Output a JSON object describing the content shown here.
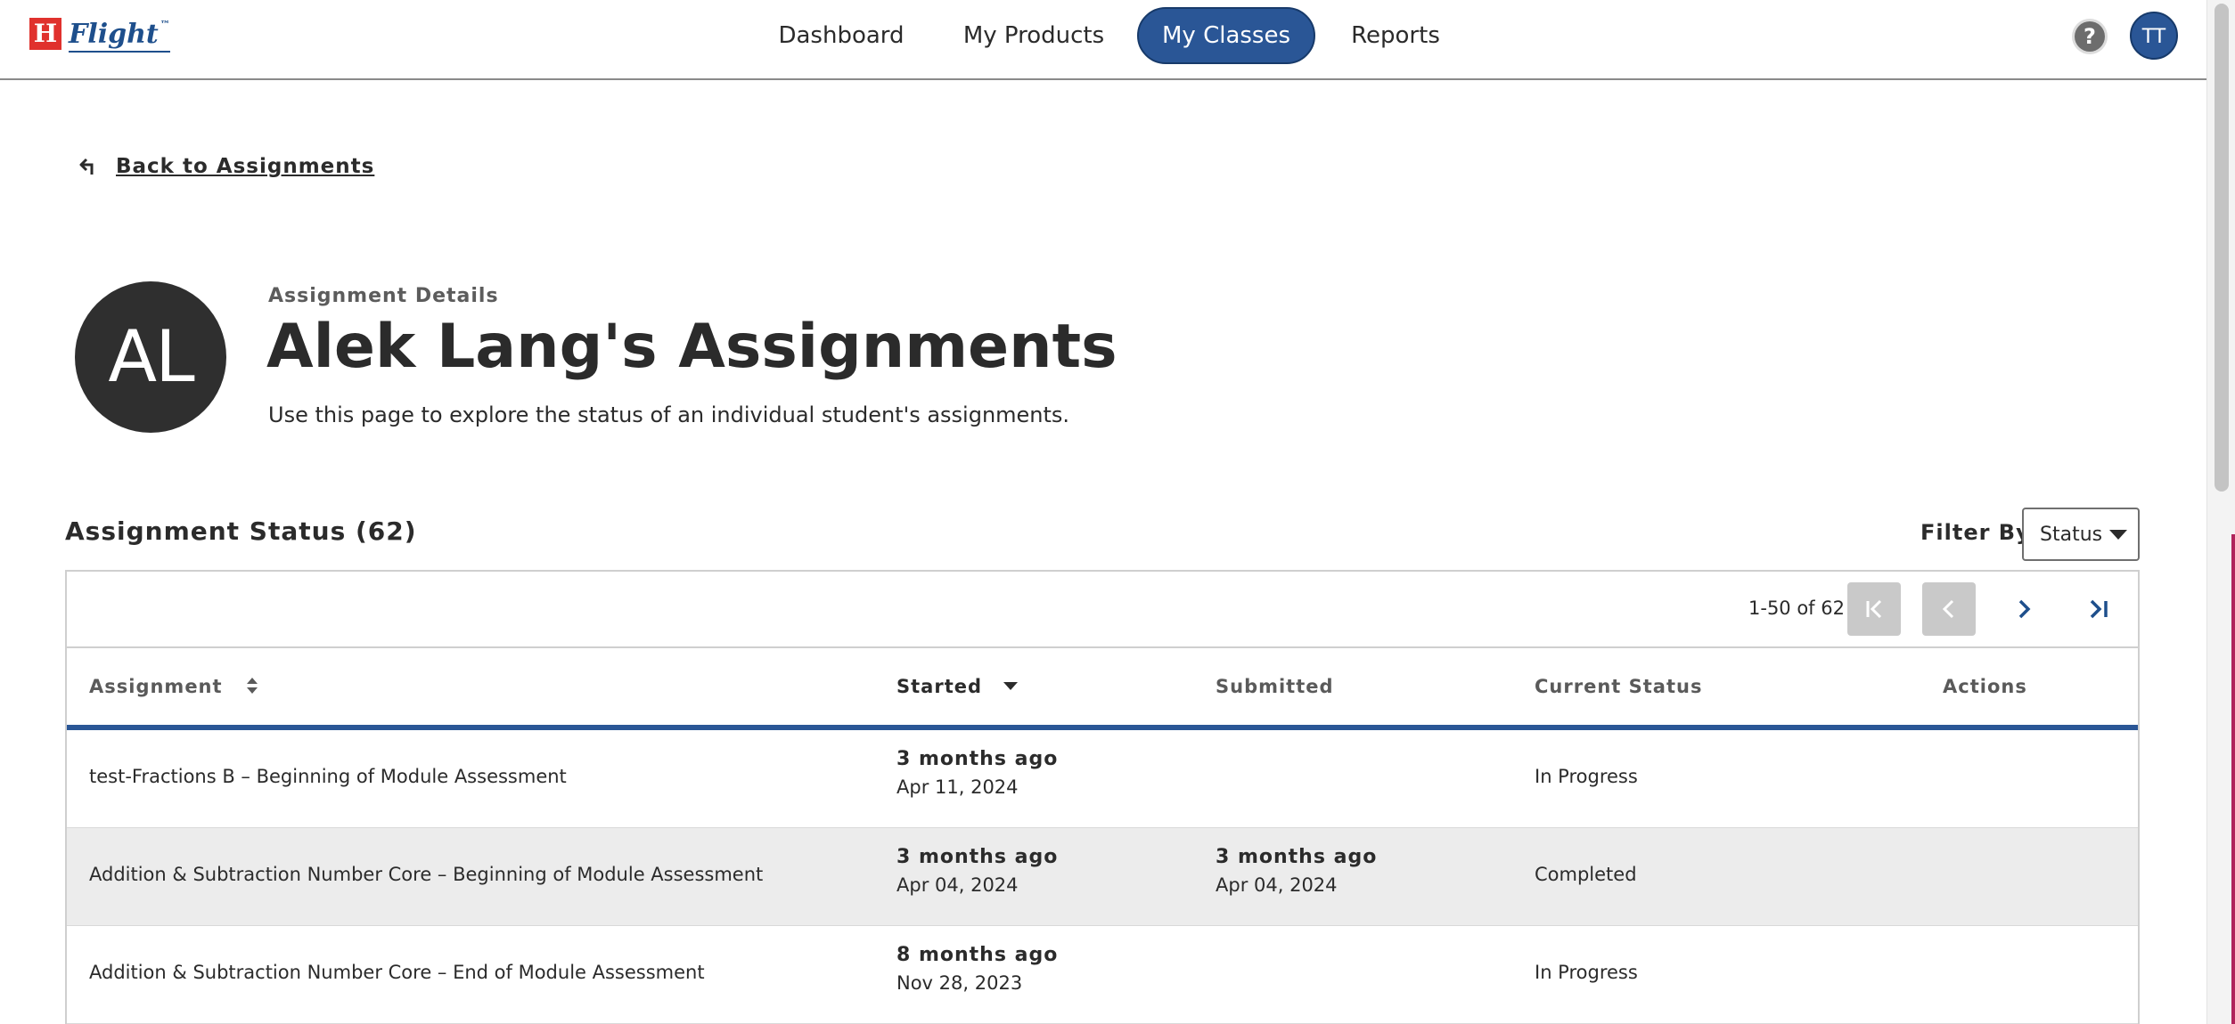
{
  "logo": {
    "mark": "H",
    "name": "Flight",
    "tm": "™"
  },
  "nav": {
    "items": [
      "Dashboard",
      "My Products",
      "My Classes",
      "Reports"
    ],
    "active": "My Classes"
  },
  "header_actions": {
    "help_glyph": "?",
    "user_initials": "TT"
  },
  "back_link": {
    "label": "Back to Assignments"
  },
  "student": {
    "initials": "AL",
    "eyebrow": "Assignment Details",
    "title": "Alek Lang's Assignments",
    "subtitle": "Use this page to explore the status of an individual student's assignments."
  },
  "section": {
    "title": "Assignment Status (62)",
    "filter_label": "Filter By",
    "filter_value": "Status"
  },
  "pager": {
    "range": "1-50 of 62"
  },
  "table": {
    "columns": [
      "Assignment",
      "Started",
      "Submitted",
      "Current Status",
      "Actions"
    ],
    "rows": [
      {
        "assignment": "test-Fractions B – Beginning of Module Assessment",
        "started_rel": "3 months ago",
        "started_date": "Apr 11, 2024",
        "submitted_rel": "",
        "submitted_date": "",
        "status": "In Progress"
      },
      {
        "assignment": "Addition & Subtraction Number Core – Beginning of Module Assessment",
        "started_rel": "3 months ago",
        "started_date": "Apr 04, 2024",
        "submitted_rel": "3 months ago",
        "submitted_date": "Apr 04, 2024",
        "status": "Completed"
      },
      {
        "assignment": "Addition & Subtraction Number Core – End of Module Assessment",
        "started_rel": "8 months ago",
        "started_date": "Nov 28, 2023",
        "submitted_rel": "",
        "submitted_date": "",
        "status": "In Progress"
      }
    ]
  },
  "colors": {
    "accent": "#2a5696",
    "brand_red": "#e0312d",
    "avatar_dark": "#2f2f2f",
    "disabled": "#c9c9c9"
  },
  "icons": [
    "back-arrow-icon",
    "help-icon",
    "sort-icon",
    "sort-down-icon",
    "caret-down-icon",
    "first-page-icon",
    "prev-page-icon",
    "next-page-icon",
    "last-page-icon"
  ]
}
